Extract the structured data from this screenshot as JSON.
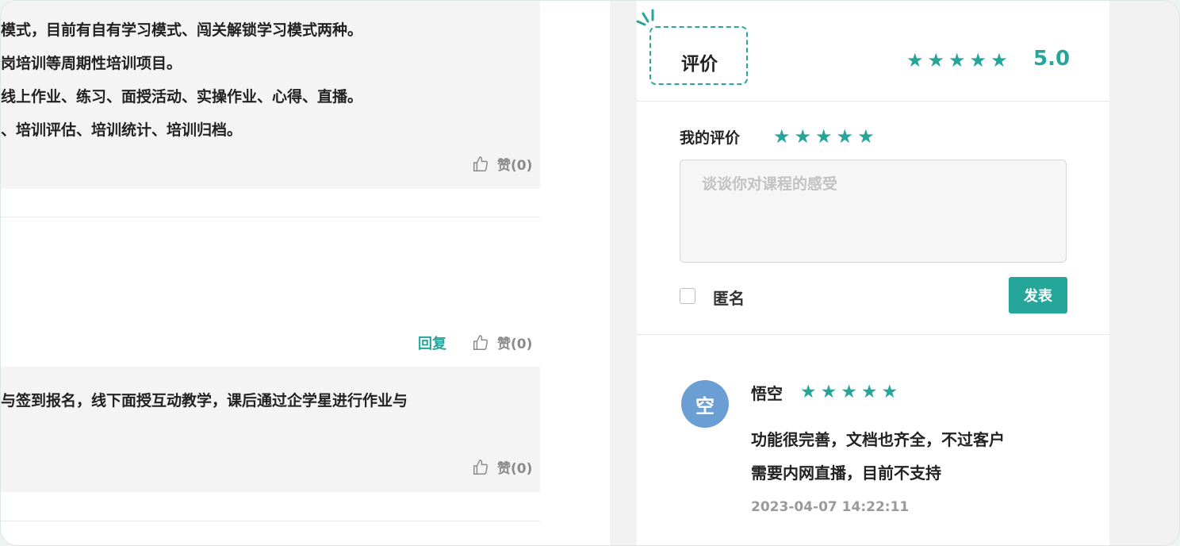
{
  "comments": {
    "block1_lines": [
      "模式，目前有自有学习模式、闯关解锁学习模式两种。",
      "岗培训等周期性培训项目。",
      "线上作业、练习、面授活动、实操作业、心得、直播。",
      "、培训评估、培训统计、培训归档。"
    ],
    "like1": "赞(0)",
    "reply_label": "回复",
    "like2": "赞(0)",
    "block2_line": "与签到报名，线下面授互动教学，课后通过企学星进行作业与",
    "like3": "赞(0)"
  },
  "review": {
    "title": "评价",
    "overall_stars": 5,
    "overall_score": "5.0",
    "my_review_label": "我的评价",
    "my_stars": 5,
    "placeholder": "谈谈你对课程的感受",
    "anonymous_label": "匿名",
    "submit_label": "发表",
    "item": {
      "avatar_text": "空",
      "user": "悟空",
      "stars": 5,
      "lines": [
        "功能很完善，文档也齐全，不过客户",
        "需要内网直播，目前不支持"
      ],
      "date": "2023-04-07 14:22:11"
    }
  },
  "colors": {
    "accent": "#26a69a",
    "avatar": "#6b9fd4"
  },
  "icons": {
    "like": "thumbs-up-icon",
    "star": "star-icon",
    "accent": "sparkle-icon"
  }
}
